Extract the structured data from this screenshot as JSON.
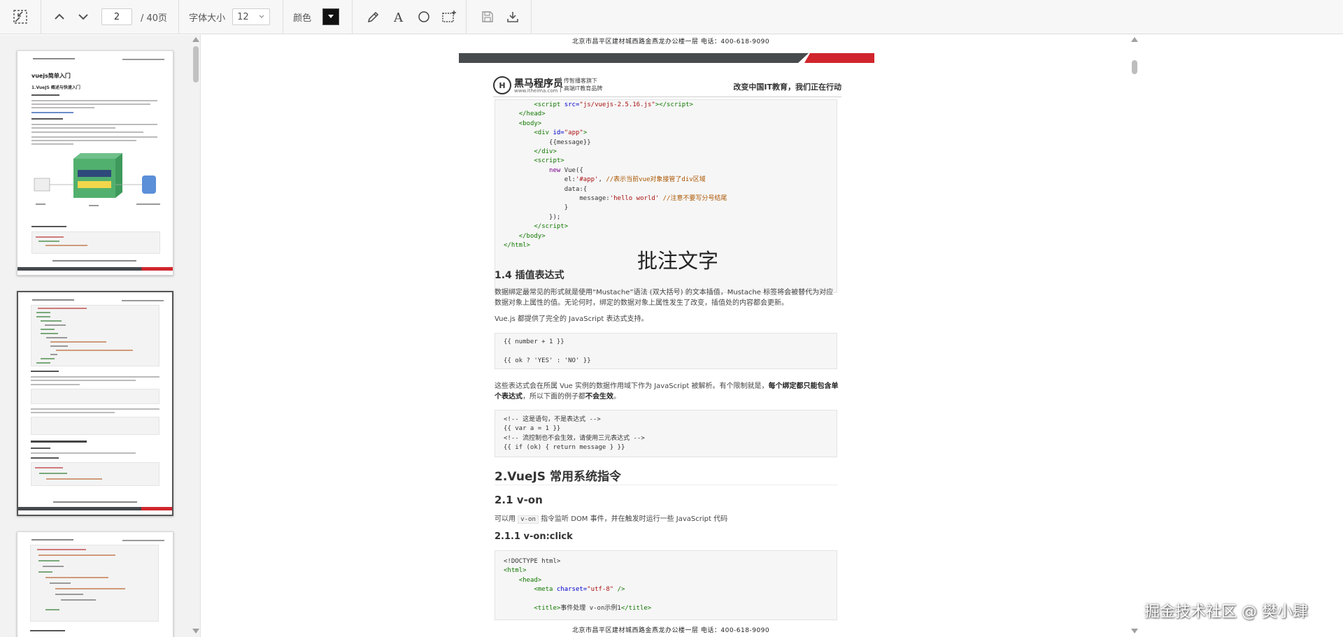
{
  "toolbar": {
    "current_page": "2",
    "total_pages": "/ 40页",
    "font_size_label": "字体大小",
    "font_size_value": "12",
    "color_label": "颜色",
    "color_value": "#111111"
  },
  "document": {
    "header_address": "北京市昌平区建材城西路金燕龙办公楼一层      电话：400-618-9090",
    "footer_address": "北京市昌平区建材城西路金燕龙办公楼一层      电话：400-618-9090",
    "brand_name": "黑马程序员",
    "brand_site": "www.itheima.com",
    "brand_tag_1": "传智播客旗下",
    "brand_tag_2": "高端IT教育品牌",
    "brand_slogan": "改变中国IT教育，我们正在行动",
    "annotation_text": "批注文字",
    "section_14_title": "1.4 插值表达式",
    "section_14_p1": "数据绑定最常见的形式就是使用“Mustache”语法 (双大括号) 的文本插值，Mustache 标签将会被替代为对应数据对象上属性的值。无论何时，绑定的数据对象上属性发生了改变，插值处的内容都会更新。",
    "section_14_p2": "Vue.js 都提供了完全的 JavaScript 表达式支持。",
    "code2_line1": "{{ number + 1 }}",
    "code2_line2": "{{ ok ? 'YES' : 'NO' }}",
    "section_14_p3_a": "这些表达式会在所属 Vue 实例的数据作用域下作为 JavaScript 被解析。有个限制就是，",
    "section_14_p3_b": "每个绑定都只能包含单个表达式",
    "section_14_p3_c": "，所以下面的例子都",
    "section_14_p3_d": "不会生效",
    "section_14_p3_e": "。",
    "code3_line1": "<!-- 这是语句，不是表达式 -->",
    "code3_line2": "{{ var a = 1 }}",
    "code3_line3": "<!-- 流控制也不会生效，请使用三元表达式 -->",
    "code3_line4": "{{ if (ok) { return message } }}",
    "section_2_title": "2.VueJS 常用系统指令",
    "section_21_title": "2.1 v-on",
    "section_21_p1_a": "可以用",
    "section_21_p1_code": "v-on",
    "section_21_p1_b": "指令监听 DOM 事件，并在触发时运行一些 JavaScript 代码",
    "section_211_title": "2.1.1 v-on:click",
    "code4_line1": "<!DOCTYPE html>",
    "code4_line2": "<html>",
    "code4_line3": "<head>",
    "code4_line4_attr": "charset=",
    "code4_line4_val": "\"utf-8\"",
    "code4_line5_title": "事件处理 v-on示例1",
    "code1_src": "\"js/vuejs-2.5.16.js\"",
    "code1_div_id": "\"app\"",
    "code1_message": "{{message}}",
    "code1_el": "'#app'",
    "code1_el_comment": "//表示当前vue对象接管了div区域",
    "code1_msg_val": "'hello world'",
    "code1_msg_comment": "//注意不要写分号结尾"
  },
  "sidebar": {
    "thumb1_title": "vuejs简单入门",
    "thumb1_sub": "1.VueJS 概述与快速入门"
  },
  "watermark": "掘金技术社区 @ 樊小肆"
}
